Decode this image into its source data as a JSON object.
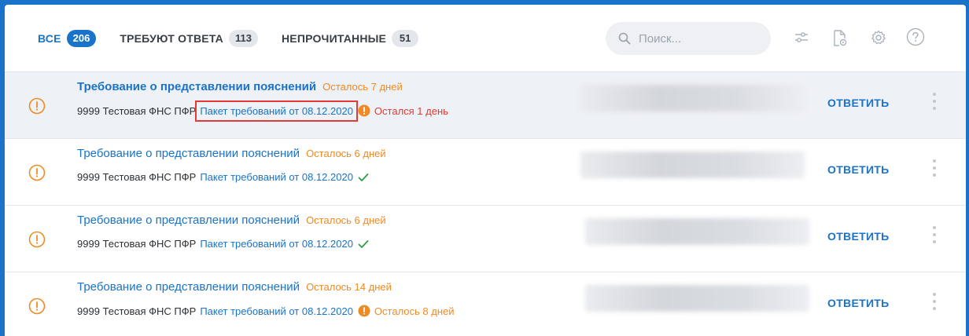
{
  "tabs": [
    {
      "label": "ВСЕ",
      "count": "206"
    },
    {
      "label": "ТРЕБУЮТ ОТВЕТА",
      "count": "113"
    },
    {
      "label": "НЕПРОЧИТАННЫЕ",
      "count": "51"
    }
  ],
  "search": {
    "placeholder": "Поиск..."
  },
  "toolbar_icons": [
    "filter-icon",
    "document-view-icon",
    "settings-icon",
    "help-icon"
  ],
  "rows": [
    {
      "title": "Требование о представлении пояснений",
      "deadline": "Осталось 7 дней",
      "org": "9999  Тестовая ФНС ПФР",
      "package": "Пакет требований от 08.12.2020",
      "status": "Остался 1 день",
      "status_type": "warning-red",
      "reply": "ОТВЕТИТЬ"
    },
    {
      "title": "Требование о представлении пояснений",
      "deadline": "Осталось 6 дней",
      "org": "9999  Тестовая ФНС ПФР",
      "package": "Пакет требований от 08.12.2020",
      "status": "",
      "status_type": "check",
      "reply": "ОТВЕТИТЬ"
    },
    {
      "title": "Требование о представлении пояснений",
      "deadline": "Осталось 6 дней",
      "org": "9999  Тестовая ФНС ПФР",
      "package": "Пакет требований от 08.12.2020",
      "status": "",
      "status_type": "check",
      "reply": "ОТВЕТИТЬ"
    },
    {
      "title": "Требование о представлении пояснений",
      "deadline": "Осталось 14 дней",
      "org": "9999  Тестовая ФНС ПФР",
      "package": "Пакет требований от 08.12.2020",
      "status": "Осталось 8 дней",
      "status_type": "warning-orange",
      "reply": "ОТВЕТИТЬ"
    }
  ],
  "colors": {
    "accent": "#1a73c8",
    "deadline": "#f08a24",
    "urgent": "#e53935",
    "ok": "#2e9e47"
  }
}
